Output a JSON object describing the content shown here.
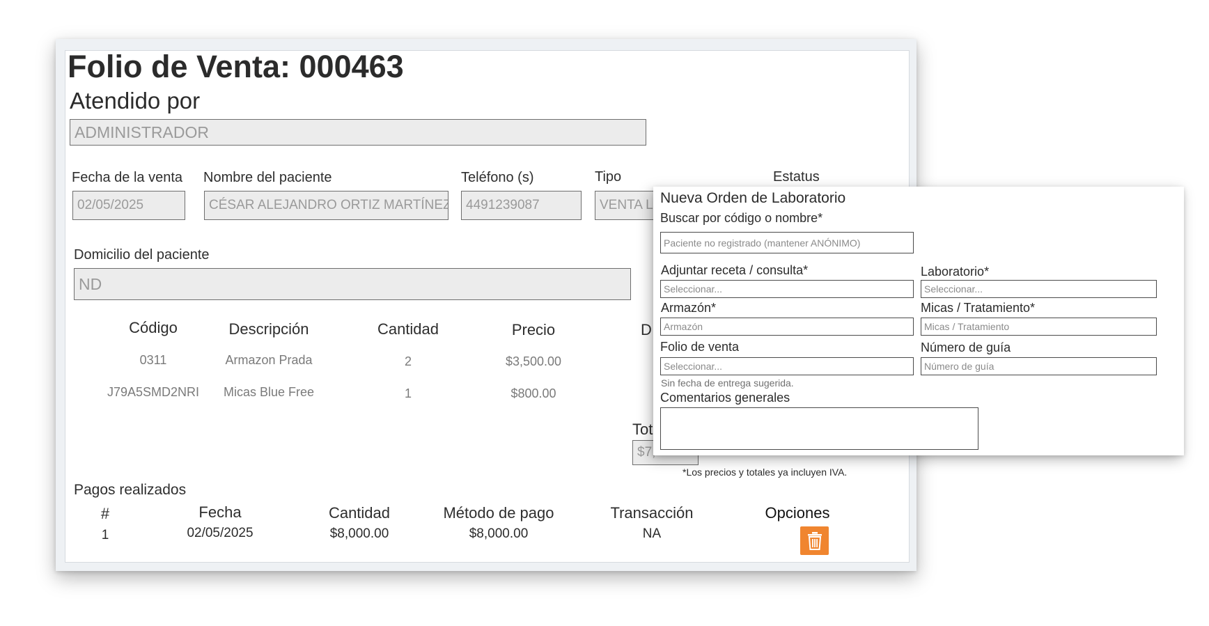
{
  "sale": {
    "title": "Folio de Venta: 000463",
    "attended_label": "Atendido por",
    "attended_value": "ADMINISTRADOR",
    "date_label": "Fecha de la venta",
    "date_value": "02/05/2025",
    "patient_label": "Nombre del paciente",
    "patient_value": "CÉSAR ALEJANDRO ORTIZ MARTÍNEZ",
    "phone_label": "Teléfono (s)",
    "phone_value": "4491239087",
    "type_label": "Tipo",
    "type_value": "VENTA LI",
    "status_label": "Estatus",
    "address_label": "Domicilio del paciente",
    "address_value": "ND",
    "products": {
      "headers": [
        "Código",
        "Descripción",
        "Cantidad",
        "Precio",
        "D"
      ],
      "rows": [
        [
          "0311",
          "Armazon Prada",
          "2",
          "$3,500.00"
        ],
        [
          "J79A5SMD2NRI",
          "Micas Blue Free",
          "1",
          "$800.00"
        ]
      ]
    },
    "total_label": "Tot",
    "total_value": "$7,",
    "tax_note": "*Los precios y totales ya incluyen IVA."
  },
  "payments": {
    "title": "Pagos realizados",
    "headers": [
      "#",
      "Fecha",
      "Cantidad",
      "Método de pago",
      "Transacción",
      "Opciones"
    ],
    "rows": [
      [
        "1",
        "02/05/2025",
        "$8,000.00",
        "$8,000.00",
        "NA"
      ]
    ],
    "delete_icon": "trash-icon",
    "accent_color": "#f0852f"
  },
  "modal": {
    "title": "Nueva Orden de Laboratorio",
    "search_label": "Buscar por código o nombre*",
    "search_value": "Paciente no registrado (mantener ANÓNIMO)",
    "prescription_label": "Adjuntar receta / consulta*",
    "prescription_placeholder": "Seleccionar...",
    "lab_label": "Laboratorio*",
    "lab_placeholder": "Seleccionar...",
    "frame_label": "Armazón*",
    "frame_placeholder": "Armazón",
    "lenses_label": "Micas / Tratamiento*",
    "lenses_placeholder": "Micas / Tratamiento",
    "folio_label": "Folio de venta",
    "folio_placeholder": "Seleccionar...",
    "guide_label": "Número de guía",
    "guide_placeholder": "Número de guía",
    "delivery_hint": "Sin fecha de entrega sugerida.",
    "comments_label": "Comentarios generales"
  }
}
